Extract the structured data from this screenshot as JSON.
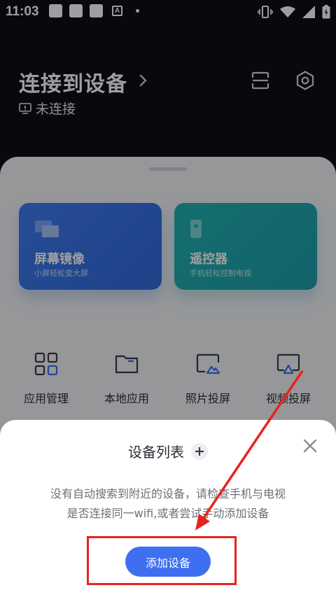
{
  "status_bar": {
    "time": "11:03",
    "notif_letter": "A"
  },
  "header": {
    "title": "连接到设备",
    "connection_status": "未连接"
  },
  "cards": [
    {
      "title": "屏幕镜像",
      "subtitle": "小屏轻松变大屏",
      "color": "#3f7cf2"
    },
    {
      "title": "遥控器",
      "subtitle": "手机轻松控制电视",
      "color": "#22b3b2"
    }
  ],
  "tools": [
    {
      "label": "应用管理",
      "icon": "grid-apps-icon"
    },
    {
      "label": "本地应用",
      "icon": "folder-icon"
    },
    {
      "label": "照片投屏",
      "icon": "photo-cast-icon"
    },
    {
      "label": "视频投屏",
      "icon": "video-cast-icon"
    }
  ],
  "dialog": {
    "title": "设备列表",
    "message_line1": "没有自动搜索到附近的设备，请检查手机与电视",
    "message_line2": "是否连接同一wifi,或者尝试手动添加设备",
    "add_button": "添加设备"
  },
  "colors": {
    "accent": "#3d6ff0",
    "annotation": "#e8231d",
    "background": "#0e1019"
  }
}
